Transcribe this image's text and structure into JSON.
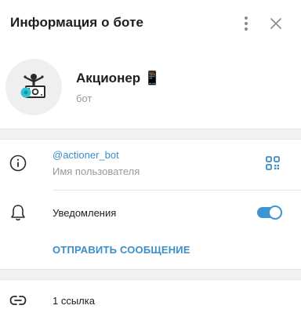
{
  "header": {
    "title": "Информация о боте",
    "more_icon": "more-vertical-icon",
    "close_icon": "close-icon"
  },
  "profile": {
    "name": "Акционер 📱",
    "status": "бот",
    "avatar_icon": "money-person-icon"
  },
  "info": {
    "username": "@actioner_bot",
    "username_caption": "Имя пользователя",
    "info_icon": "info-icon",
    "qr_icon": "qr-code-icon"
  },
  "notifications": {
    "label": "Уведомления",
    "enabled": true,
    "bell_icon": "bell-icon"
  },
  "actions": {
    "send_message": "ОТПРАВИТЬ СООБЩЕНИЕ"
  },
  "links": {
    "label": "1 ссылка",
    "link_icon": "link-icon"
  },
  "colors": {
    "accent": "#3a8fc8",
    "toggle": "#3c94d3",
    "muted": "#999999",
    "avatar_badge": "#2ec4d8"
  }
}
